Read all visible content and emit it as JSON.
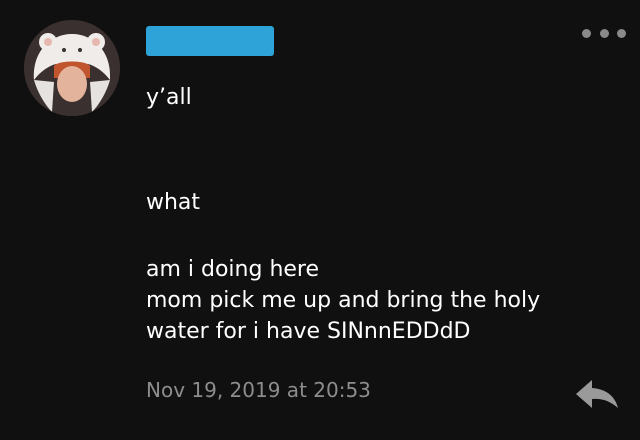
{
  "post": {
    "username_redacted": true,
    "message_lines": [
      "y’all",
      "what",
      "am i doing here",
      "mom pick me up and bring the holy",
      "water for i have SINnnEDDdD"
    ],
    "timestamp": "Nov 19, 2019 at 20:53"
  },
  "colors": {
    "background": "#101010",
    "text": "#ffffff",
    "muted": "#8d8d8d",
    "redaction": "#2ea3d8"
  },
  "icons": {
    "menu": "more-horizontal-icon",
    "reply": "reply-arrow-icon"
  }
}
